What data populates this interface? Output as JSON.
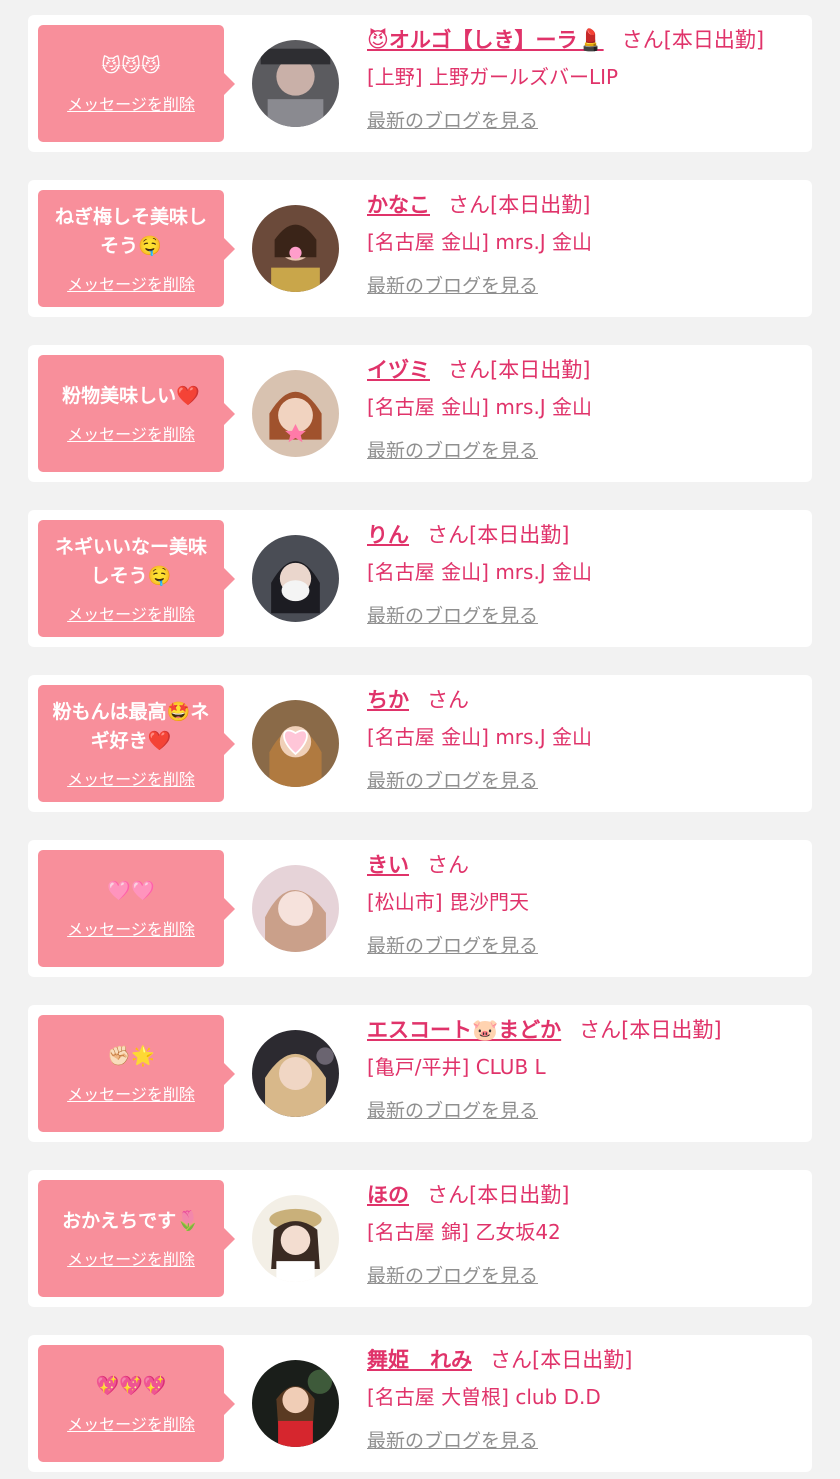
{
  "delete_label": "メッセージを削除",
  "blog_label": "最新のブログを見る",
  "cards": [
    {
      "message": "😼😼😼",
      "name": "😈オルゴ【しき】ーラ💄",
      "suffix": "さん[本日出勤]",
      "shop": "[上野] 上野ガールズバーLIP"
    },
    {
      "message": "ねぎ梅しそ美味しそう🤤",
      "name": "かなこ",
      "suffix": "さん[本日出勤]",
      "shop": "[名古屋 金山] mrs.J 金山"
    },
    {
      "message": "粉物美味しい❤️",
      "name": "イヅミ",
      "suffix": "さん[本日出勤]",
      "shop": "[名古屋 金山] mrs.J 金山"
    },
    {
      "message": "ネギいいなー美味しそう🤤",
      "name": "りん",
      "suffix": "さん[本日出勤]",
      "shop": "[名古屋 金山] mrs.J 金山"
    },
    {
      "message": "粉もんは最高🤩ネギ好き❤️",
      "name": "ちか",
      "suffix": "さん",
      "shop": "[名古屋 金山] mrs.J 金山"
    },
    {
      "message": "🩷🩷",
      "name": "きい",
      "suffix": "さん",
      "shop": "[松山市] 毘沙門天"
    },
    {
      "message": "✊🏻🌟",
      "name": "エスコート🐷まどか",
      "suffix": "さん[本日出勤]",
      "shop": "[亀戸/平井] CLUB L"
    },
    {
      "message": "おかえちです🌷",
      "name": "ほの",
      "suffix": "さん[本日出勤]",
      "shop": "[名古屋 錦] 乙女坂42"
    },
    {
      "message": "💖💖💖",
      "name": "舞姫　れみ",
      "suffix": "さん[本日出勤]",
      "shop": "[名古屋 大曽根] club D.D"
    }
  ],
  "colors": {
    "bubble": "#f88f9b",
    "name": "#e0336a",
    "blog_link": "#8f8f8f",
    "background": "#f2f2f2"
  }
}
